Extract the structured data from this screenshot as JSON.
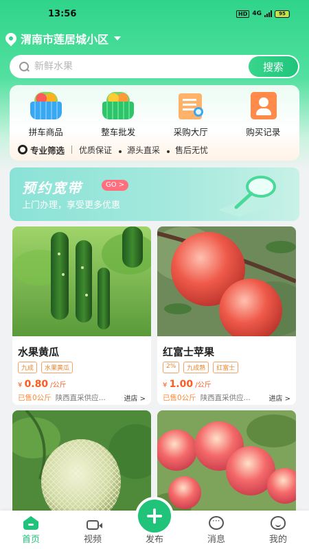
{
  "status_bar": {
    "time": "13:56",
    "hd": "HD",
    "network": "4G",
    "battery": "95"
  },
  "location": {
    "text": "渭南市莲居城小区"
  },
  "search": {
    "placeholder": "新鲜水果",
    "button_label": "搜索"
  },
  "categories": [
    {
      "label": "拼车商品",
      "icon": "fruit-basket-icon"
    },
    {
      "label": "整车批发",
      "icon": "green-basket-icon"
    },
    {
      "label": "采购大厅",
      "icon": "document-search-icon"
    },
    {
      "label": "购买记录",
      "icon": "user-record-icon"
    }
  ],
  "features": {
    "title": "专业筛选",
    "items": [
      "优质保证",
      "源头直采",
      "售后无忧"
    ]
  },
  "promo": {
    "title": "预约宽带",
    "go_label": "GO >",
    "subtitle": "上门办理，享受更多优惠"
  },
  "products": [
    {
      "name": "水果黄瓜",
      "tags": [
        "九成",
        "水果黄瓜"
      ],
      "price_symbol": "¥",
      "price": "0.80",
      "unit": "/公斤",
      "sold": "已售0公斤",
      "supplier": "陕西直采供应...",
      "shop_link": "进店 >"
    },
    {
      "name": "红富士苹果",
      "tags": [
        "2%",
        "九成熟",
        "红富士"
      ],
      "price_symbol": "¥",
      "price": "1.00",
      "unit": "/公斤",
      "sold": "已售0公斤",
      "supplier": "陕西直采供应...",
      "shop_link": "进店 >"
    }
  ],
  "tab_bar": {
    "home": "首页",
    "video": "视频",
    "publish": "发布",
    "messages": "消息",
    "mine": "我的"
  },
  "colors": {
    "accent": "#1fc47a",
    "price": "#ff5a1f",
    "tag": "#e8862f"
  }
}
